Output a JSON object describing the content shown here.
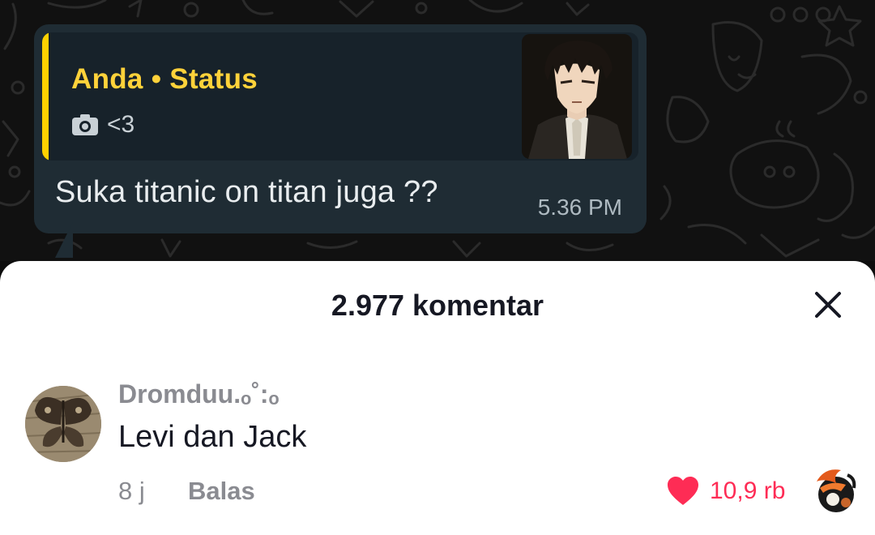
{
  "chat": {
    "quote": {
      "title": "Anda • Status",
      "caption": "<3",
      "icon": "camera-icon",
      "accent_color": "#ffd100"
    },
    "message": {
      "text": "Suka titanic on titan juga ??",
      "time": "5.36 PM"
    }
  },
  "comments": {
    "header": {
      "count_label": "2.977 komentar",
      "close_icon": "close-icon"
    },
    "items": [
      {
        "username": "Dromduu.ₒ˚:ₒ",
        "text": "Levi dan Jack",
        "time": "8 j",
        "reply_label": "Balas",
        "like_count": "10,9 rb",
        "like_icon": "heart-icon",
        "like_color": "#fe2c55"
      }
    ]
  }
}
